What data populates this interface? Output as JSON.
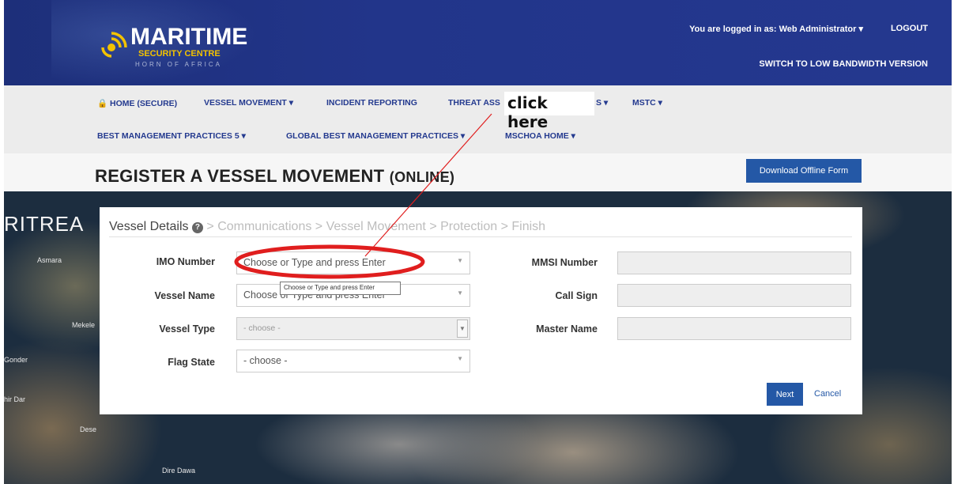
{
  "header": {
    "logo": {
      "title": "MARITIME",
      "subtitle": "SECURITY CENTRE",
      "tagline": "HORN OF AFRICA"
    },
    "user_line": "You are logged in as: Web Administrator ▾",
    "logout": "LOGOUT",
    "low_bandwidth": "SWITCH TO LOW BANDWIDTH VERSION"
  },
  "nav": {
    "row1": [
      {
        "label": "🔒 HOME (SECURE)"
      },
      {
        "label": "VESSEL MOVEMENT ▾"
      },
      {
        "label": "INCIDENT REPORTING"
      },
      {
        "label": "THREAT ASS"
      },
      {
        "label": "S ▾"
      },
      {
        "label": "MSTC ▾"
      }
    ],
    "row2": [
      {
        "label": "BEST MANAGEMENT PRACTICES 5 ▾"
      },
      {
        "label": "GLOBAL BEST MANAGEMENT PRACTICES ▾"
      },
      {
        "label": "MSCHOA HOME ▾"
      }
    ]
  },
  "page": {
    "title_main": "REGISTER A VESSEL MOVEMENT",
    "title_suffix": "(ONLINE)",
    "download_button": "Download Offline Form"
  },
  "map_labels": {
    "country": "RITREA",
    "cities": [
      "Asmara",
      "Mekele",
      "Gonder",
      "hir Dar",
      "Dese",
      "Dire Dawa"
    ]
  },
  "wizard": {
    "steps": {
      "active": "Vessel Details",
      "help_glyph": "?",
      "rest": "> Communications > Vessel Movement > Protection > Finish"
    },
    "left_fields": [
      {
        "label": "IMO Number",
        "value": "Choose or Type and press Enter"
      },
      {
        "label": "Vessel Name",
        "value": "Choose or Type and press Enter"
      },
      {
        "label": "Vessel Type",
        "value": "- choose -"
      },
      {
        "label": "Flag State",
        "value": "- choose -"
      }
    ],
    "right_fields": [
      {
        "label": "MMSI Number",
        "value": ""
      },
      {
        "label": "Call Sign",
        "value": ""
      },
      {
        "label": "Master Name",
        "value": ""
      }
    ],
    "tooltip": "Choose or Type and press Enter",
    "next": "Next",
    "cancel": "Cancel"
  },
  "annotation": {
    "text": "click here",
    "color": "#e01e1e"
  }
}
